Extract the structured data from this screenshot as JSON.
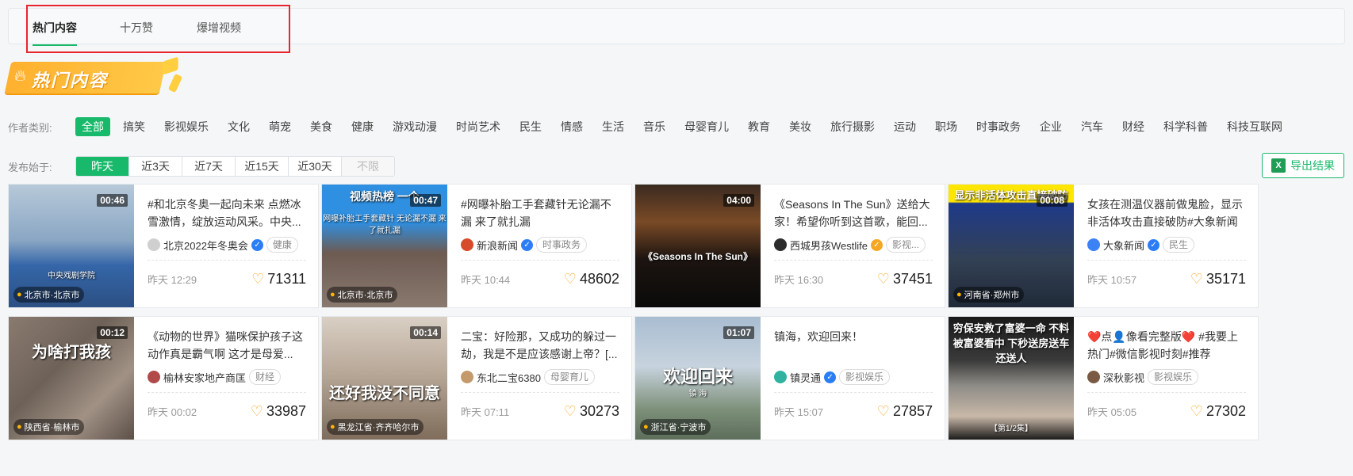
{
  "tabs": [
    "热门内容",
    "十万赞",
    "爆增视频"
  ],
  "banner": {
    "text": "热门内容",
    "icon": "flame-icon"
  },
  "filters": {
    "category_label": "作者类别:",
    "categories": [
      "全部",
      "搞笑",
      "影视娱乐",
      "文化",
      "萌宠",
      "美食",
      "健康",
      "游戏动漫",
      "时尚艺术",
      "民生",
      "情感",
      "生活",
      "音乐",
      "母婴育儿",
      "教育",
      "美妆",
      "旅行摄影",
      "运动",
      "职场",
      "时事政务",
      "企业",
      "汽车",
      "财经",
      "科学科普",
      "科技互联网"
    ],
    "active_category": "全部",
    "date_label": "发布始于:",
    "dates": [
      "昨天",
      "近3天",
      "近7天",
      "近15天",
      "近30天",
      "不限"
    ],
    "active_date": "昨天",
    "disabled_date": "不限"
  },
  "export": {
    "label": "导出结果",
    "icon": "excel-icon"
  },
  "accent_color": "#19b96b",
  "cards": [
    {
      "duration": "00:46",
      "location": "北京市·北京市",
      "title": "#和北京冬奥一起向未来 点燃冰雪激情，绽放运动风采。中央...",
      "author": "北京2022年冬奥会",
      "verified": "blue",
      "tag": "健康",
      "time": "昨天 12:29",
      "likes": "71311",
      "thumb_caption": "",
      "thumb_subcaption": "中央戏剧学院"
    },
    {
      "duration": "00:47",
      "location": "北京市·北京市",
      "title": "#网曝补胎工手套藏针无论漏不漏 来了就扎漏",
      "author": "新浪新闻",
      "verified": "blue",
      "tag": "时事政务",
      "time": "昨天 10:44",
      "likes": "48602",
      "thumb_caption": "视频热榜 一个",
      "thumb_subcaption": "网曝补胎工手套藏针 无论漏不漏 来了就扎漏"
    },
    {
      "duration": "04:00",
      "location": "",
      "title": "《Seasons In The Sun》送给大家！希望你听到这首歌，能回...",
      "author": "西城男孩Westlife",
      "verified": "gold",
      "tag": "影视...",
      "time": "昨天 16:30",
      "likes": "37451",
      "thumb_caption": "《Seasons In The Sun》",
      "thumb_subcaption": ""
    },
    {
      "duration": "00:08",
      "location": "河南省·郑州市",
      "title": "女孩在测温仪器前做鬼脸，显示非活体攻击直接破防#大象新闻",
      "author": "大象新闻",
      "verified": "blue",
      "tag": "民生",
      "time": "昨天 10:57",
      "likes": "35171",
      "thumb_caption": "显示非活体攻击直接破防",
      "thumb_subcaption": ""
    },
    {
      "duration": "00:12",
      "location": "陕西省·榆林市",
      "title": "《动物的世界》猫咪保护孩子这动作真是霸气啊 这才是母爱...",
      "author": "榆林安家地产商匡",
      "verified": "",
      "tag": "财经",
      "time": "昨天 00:02",
      "likes": "33987",
      "thumb_caption": "为啥打我孩",
      "thumb_subcaption": ""
    },
    {
      "duration": "00:14",
      "location": "黑龙江省·齐齐哈尔市",
      "title": "二宝：好险那，又成功的躲过一劫，我是不是应该感谢上帝？[...",
      "author": "东北二宝6380",
      "verified": "",
      "tag": "母婴育儿",
      "time": "昨天 07:11",
      "likes": "30273",
      "thumb_caption": "还好我没不同意",
      "thumb_subcaption": ""
    },
    {
      "duration": "01:07",
      "location": "浙江省·宁波市",
      "title": "镇海，欢迎回来！",
      "author": "镇灵通",
      "verified": "blue",
      "tag": "影视娱乐",
      "time": "昨天 15:07",
      "likes": "27857",
      "thumb_caption": "欢迎回来",
      "thumb_subcaption": "镇 海"
    },
    {
      "duration": "",
      "location": "",
      "title": "❤️点👤像看完整版❤️ #我要上热门#微信影视时刻#推荐",
      "author": "深秋影视",
      "verified": "",
      "tag": "影视娱乐",
      "time": "昨天 05:05",
      "likes": "27302",
      "thumb_caption": "穷保安救了富婆一命 不料被富婆看中 下秒送房送车还送人",
      "thumb_subcaption": "【第1/2集】"
    }
  ]
}
